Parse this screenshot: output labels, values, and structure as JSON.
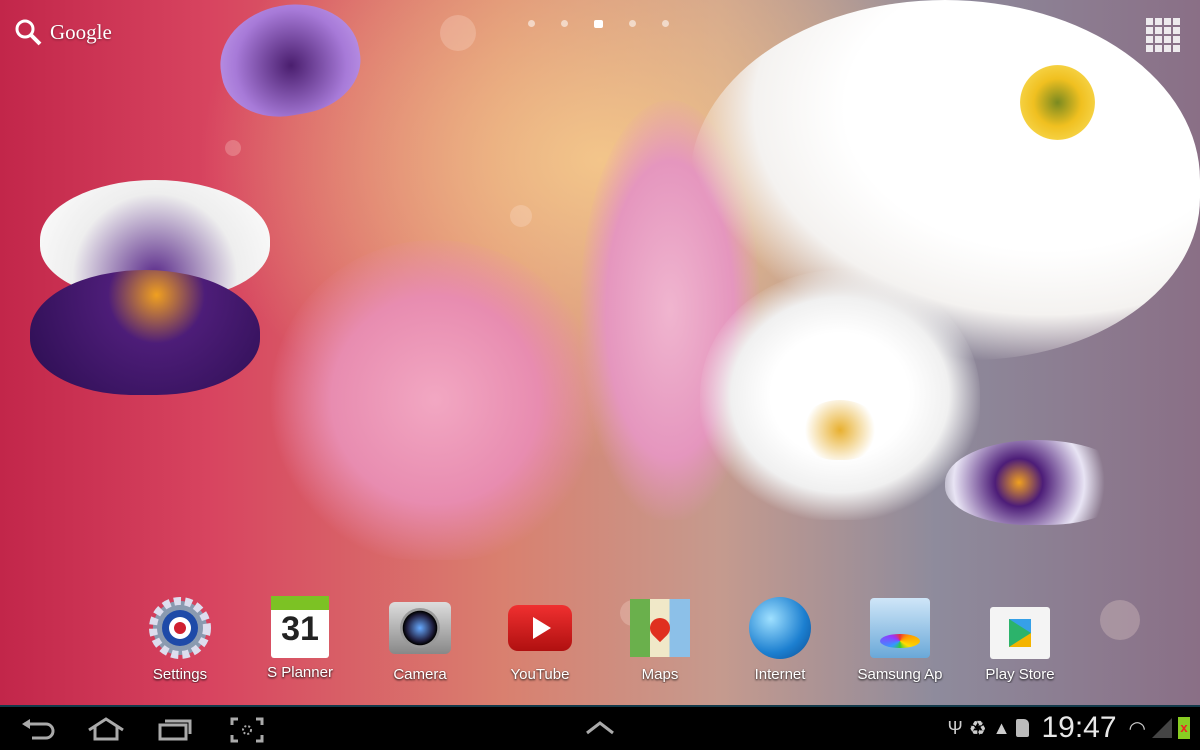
{
  "home": {
    "search_label": "Google",
    "page_count": 5,
    "active_page": 3
  },
  "dock": [
    {
      "label": "Settings",
      "icon": "settings-icon"
    },
    {
      "label": "S Planner",
      "icon": "calendar-icon",
      "day": "31"
    },
    {
      "label": "Camera",
      "icon": "camera-icon"
    },
    {
      "label": "YouTube",
      "icon": "youtube-icon"
    },
    {
      "label": "Maps",
      "icon": "maps-icon"
    },
    {
      "label": "Internet",
      "icon": "globe-icon"
    },
    {
      "label": "Samsung Ap",
      "icon": "samsung-apps-icon"
    },
    {
      "label": "Play Store",
      "icon": "play-store-icon"
    }
  ],
  "status": {
    "time": "19:47"
  }
}
